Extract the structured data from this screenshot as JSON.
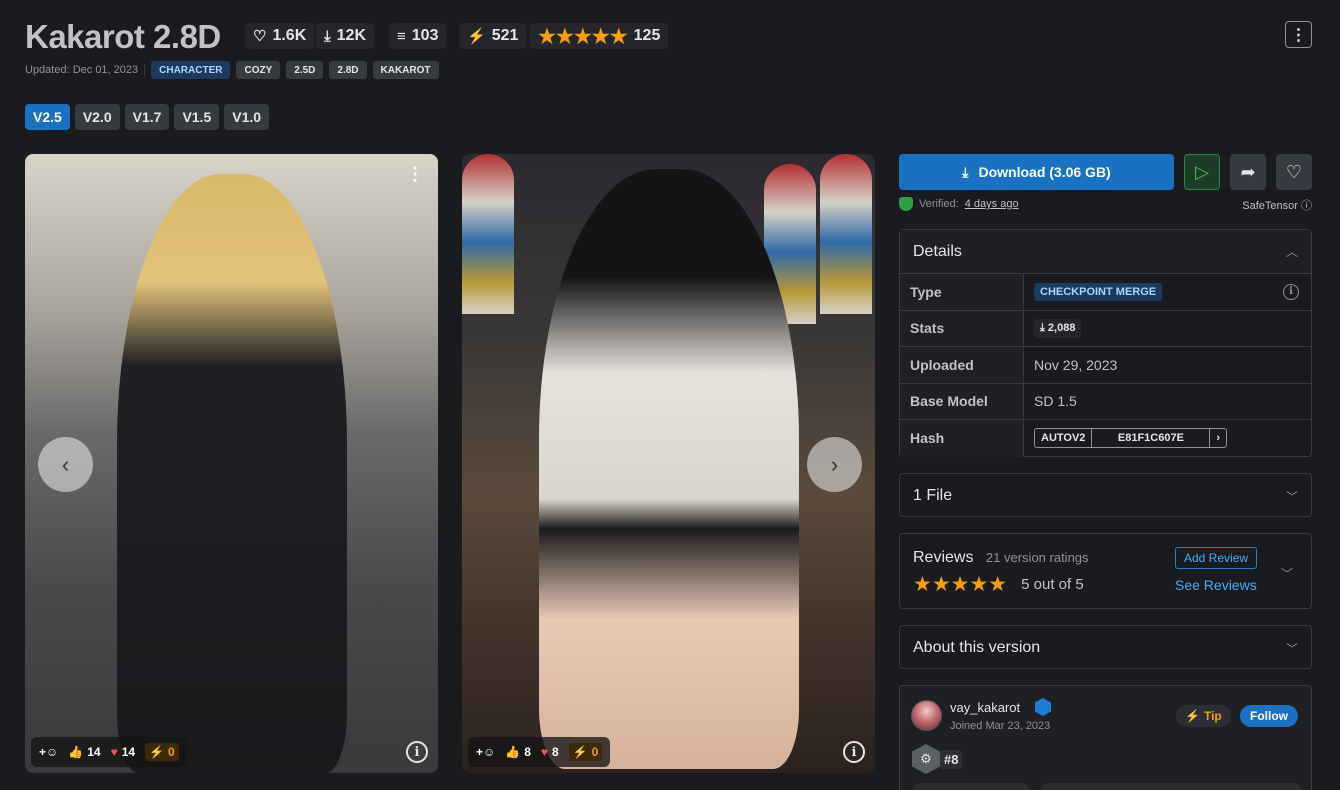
{
  "model": {
    "title": "Kakarot 2.8D",
    "stats": {
      "likes": "1.6K",
      "downloads": "12K",
      "collections": "103",
      "buzz": "521",
      "rating_count": "125"
    },
    "stars": "★★★★★",
    "updated": "Updated: Dec 01, 2023",
    "tags": [
      "CHARACTER",
      "COZY",
      "2.5D",
      "2.8D",
      "KAKAROT"
    ]
  },
  "versions": [
    "V2.5",
    "V2.0",
    "V1.7",
    "V1.5",
    "V1.0"
  ],
  "images": [
    {
      "thumbs": "14",
      "hearts": "14",
      "buzz": "0"
    },
    {
      "thumbs": "8",
      "hearts": "8",
      "buzz": "0"
    }
  ],
  "download": {
    "label": "Download (3.06 GB)",
    "verified_prefix": "Verified:",
    "verified_date": "4 days ago",
    "format": "SafeTensor"
  },
  "details": {
    "title": "Details",
    "rows": [
      {
        "key": "Type",
        "value": "CHECKPOINT MERGE"
      },
      {
        "key": "Stats",
        "value": "2,088"
      },
      {
        "key": "Uploaded",
        "value": "Nov 29, 2023"
      },
      {
        "key": "Base Model",
        "value": "SD 1.5"
      },
      {
        "key": "Hash",
        "algo": "AUTOV2",
        "value": "E81F1C607E"
      }
    ]
  },
  "files": {
    "title": "1 File"
  },
  "reviews": {
    "title": "Reviews",
    "count": "21 version ratings",
    "summary": "5 out of 5",
    "add": "Add Review",
    "see": "See Reviews",
    "stars": "★★★★★"
  },
  "about": {
    "title": "About this version"
  },
  "creator": {
    "name": "vay_kakarot",
    "joined": "Joined Mar 23, 2023",
    "tip": "Tip",
    "follow": "Follow",
    "rank": "#8"
  },
  "colors": {
    "accent": "#1971c2",
    "star": "#f59f00",
    "verified": "#2f9e44"
  }
}
